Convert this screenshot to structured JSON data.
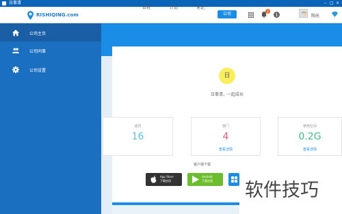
{
  "window": {
    "title": "日事清"
  },
  "header": {
    "brand": "RISHIQING.com",
    "tabs": [
      {
        "label": "日程"
      },
      {
        "label": "计划"
      },
      {
        "label": "笔记"
      },
      {
        "label": "公司",
        "active": true
      }
    ],
    "notification_count": "1",
    "username": "阳光"
  },
  "sidebar": {
    "items": [
      {
        "label": "公司主页",
        "icon": "home-icon",
        "active": true
      },
      {
        "label": "公司同事",
        "icon": "people-icon"
      },
      {
        "label": "公司设置",
        "icon": "gear-icon"
      }
    ]
  },
  "main": {
    "day_badge": "日",
    "slogan": "日事清，一起成长",
    "stats": [
      {
        "label": "成员",
        "value": "16",
        "color": "#5bc0de",
        "link": ""
      },
      {
        "label": "部门",
        "value": "4",
        "color": "#e05a86",
        "link": "查看详情"
      },
      {
        "label": "使用空间",
        "value": "0.2G",
        "color": "#3cbf8a",
        "link": "查看详情"
      }
    ],
    "download_label": "客户端下载",
    "downloads": [
      {
        "name": "App Store",
        "sub": "下载应用",
        "color": "#333333",
        "icon": "apple-icon"
      },
      {
        "name": "Android",
        "sub": "下载应用",
        "color": "#6dbe2f",
        "icon": "play-icon"
      },
      {
        "name": "Windows",
        "color": "#1a8ee6",
        "icon": "windows-icon"
      }
    ]
  },
  "watermark": "软件技巧",
  "colors": {
    "brand_blue": "#1a8ee6",
    "sidebar": "#1a6fc0"
  }
}
